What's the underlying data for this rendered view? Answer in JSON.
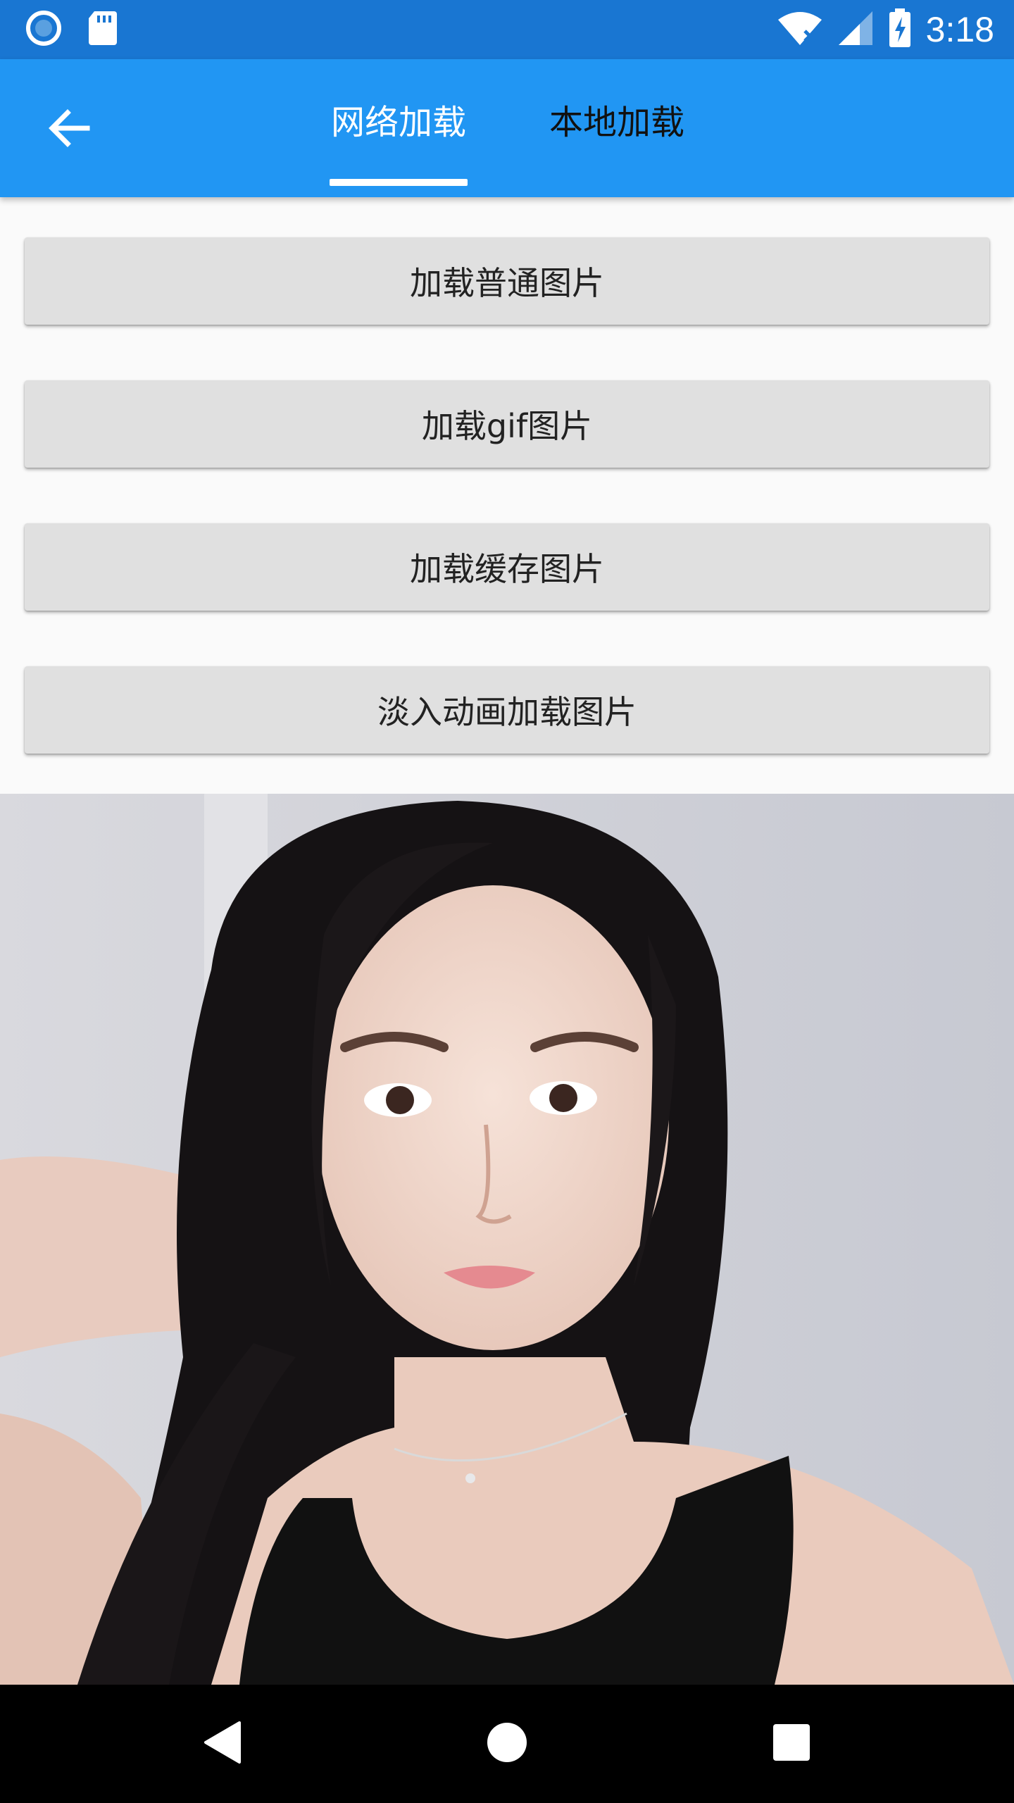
{
  "status_bar": {
    "time": "3:18",
    "icons": [
      "media-record-icon",
      "sd-card-icon",
      "wifi-no-internet-icon",
      "cell-signal-icon",
      "battery-charging-icon"
    ]
  },
  "app_bar": {
    "tabs": [
      {
        "label": "网络加载",
        "active": true
      },
      {
        "label": "本地加载",
        "active": false
      }
    ],
    "accent_color": "#2196f3"
  },
  "buttons": [
    {
      "label": "加载普通图片"
    },
    {
      "label": "加载gif图片"
    },
    {
      "label": "加载缓存图片"
    },
    {
      "label": "淡入动画加载图片"
    }
  ],
  "nav_bar": {
    "icons": [
      "back-triangle-icon",
      "home-circle-icon",
      "recents-square-icon"
    ]
  }
}
